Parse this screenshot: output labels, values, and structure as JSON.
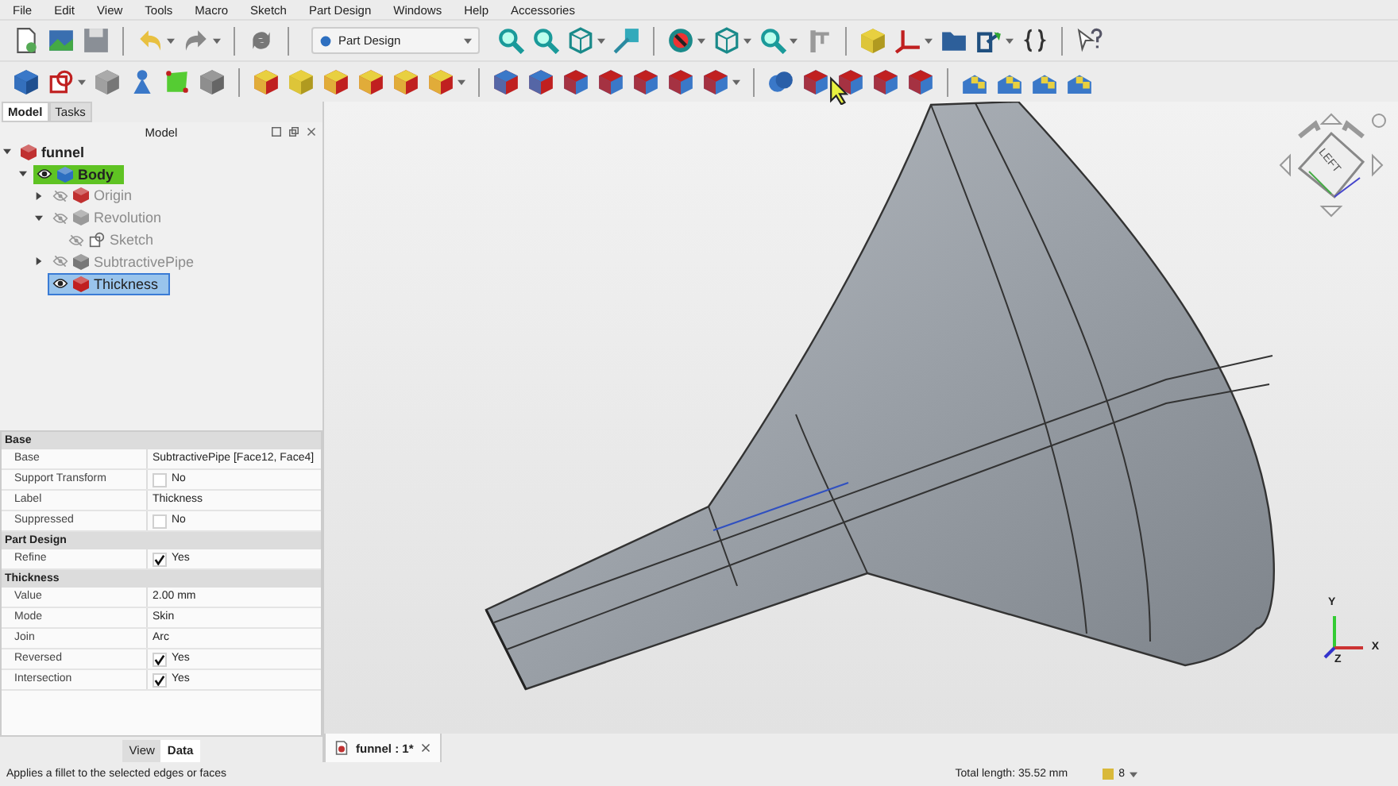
{
  "menu": [
    "File",
    "Edit",
    "View",
    "Tools",
    "Macro",
    "Sketch",
    "Part Design",
    "Windows",
    "Help",
    "Accessories"
  ],
  "workbench": "Part Design",
  "panel_tabs": [
    {
      "label": "Model",
      "selected": true
    },
    {
      "label": "Tasks",
      "selected": false
    }
  ],
  "tree": {
    "title": "Model",
    "items": [
      {
        "label": "funnel",
        "kind": "document",
        "expanded": true,
        "selected": false,
        "children": [
          {
            "label": "Body",
            "kind": "body",
            "visible": true,
            "active": true,
            "expanded": true,
            "selected": false,
            "children": [
              {
                "label": "Origin",
                "kind": "origin",
                "visible": false,
                "active": false,
                "expanded": false,
                "selected": false
              },
              {
                "label": "Revolution",
                "kind": "revolution",
                "visible": false,
                "active": false,
                "expanded": true,
                "selected": false,
                "children": [
                  {
                    "label": "Sketch",
                    "kind": "sketch",
                    "visible": false,
                    "active": false,
                    "selected": false
                  }
                ]
              },
              {
                "label": "SubtractivePipe",
                "kind": "pipe",
                "visible": false,
                "active": false,
                "expanded": false,
                "selected": false
              },
              {
                "label": "Thickness",
                "kind": "thickness",
                "visible": true,
                "active": false,
                "selected": true
              }
            ]
          }
        ]
      }
    ]
  },
  "properties": [
    {
      "group": "Base",
      "rows": [
        {
          "name": "Base",
          "kind": "text",
          "value": "SubtractivePipe [Face12, Face4]"
        },
        {
          "name": "Support Transform",
          "kind": "bool",
          "checked": false,
          "value": "No"
        },
        {
          "name": "Label",
          "kind": "text",
          "value": "Thickness"
        },
        {
          "name": "Suppressed",
          "kind": "bool",
          "checked": false,
          "value": "No"
        }
      ]
    },
    {
      "group": "Part Design",
      "rows": [
        {
          "name": "Refine",
          "kind": "bool",
          "checked": true,
          "value": "Yes"
        }
      ]
    },
    {
      "group": "Thickness",
      "rows": [
        {
          "name": "Value",
          "kind": "text",
          "value": "2.00 mm"
        },
        {
          "name": "Mode",
          "kind": "text",
          "value": "Skin"
        },
        {
          "name": "Join",
          "kind": "text",
          "value": "Arc"
        },
        {
          "name": "Reversed",
          "kind": "bool",
          "checked": true,
          "value": "Yes"
        },
        {
          "name": "Intersection",
          "kind": "bool",
          "checked": true,
          "value": "Yes"
        }
      ]
    }
  ],
  "property_tabs": [
    {
      "label": "View",
      "selected": false
    },
    {
      "label": "Data",
      "selected": true
    }
  ],
  "document_tab": {
    "label": "funnel : 1*"
  },
  "navigation_cube": {
    "face": "LEFT"
  },
  "axes": {
    "x": "X",
    "y": "Y",
    "z": "Z"
  },
  "status_bar": {
    "message": "Applies a fillet to the selected edges or faces",
    "total_length": "Total length: 35.52 mm",
    "count": "8"
  }
}
